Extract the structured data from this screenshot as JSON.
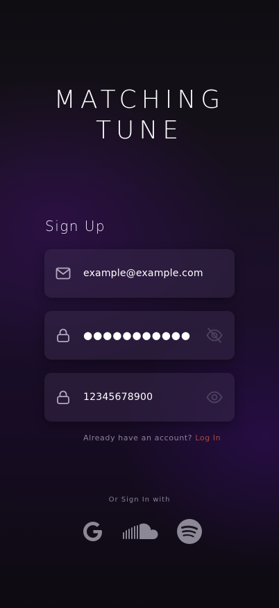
{
  "app": {
    "title_line1": "MATCHING",
    "title_line2": "TUNE"
  },
  "form": {
    "heading": "Sign Up",
    "email": {
      "value": "example@example.com",
      "icon": "mail-icon"
    },
    "password": {
      "value": "●●●●●●●●●●●",
      "icon": "lock-icon",
      "toggle_icon": "eye-off-icon"
    },
    "confirm_password": {
      "value": "12345678900",
      "icon": "lock-icon",
      "toggle_icon": "eye-icon"
    }
  },
  "account": {
    "prompt": "Already have an account?",
    "link": "Log In"
  },
  "social": {
    "label": "Or Sign In with",
    "providers": [
      "google-icon",
      "soundcloud-icon",
      "spotify-icon"
    ]
  },
  "colors": {
    "accent_link": "#a8473f",
    "field_bg": "#2a1f38",
    "icon_muted": "#b3a9c2"
  }
}
